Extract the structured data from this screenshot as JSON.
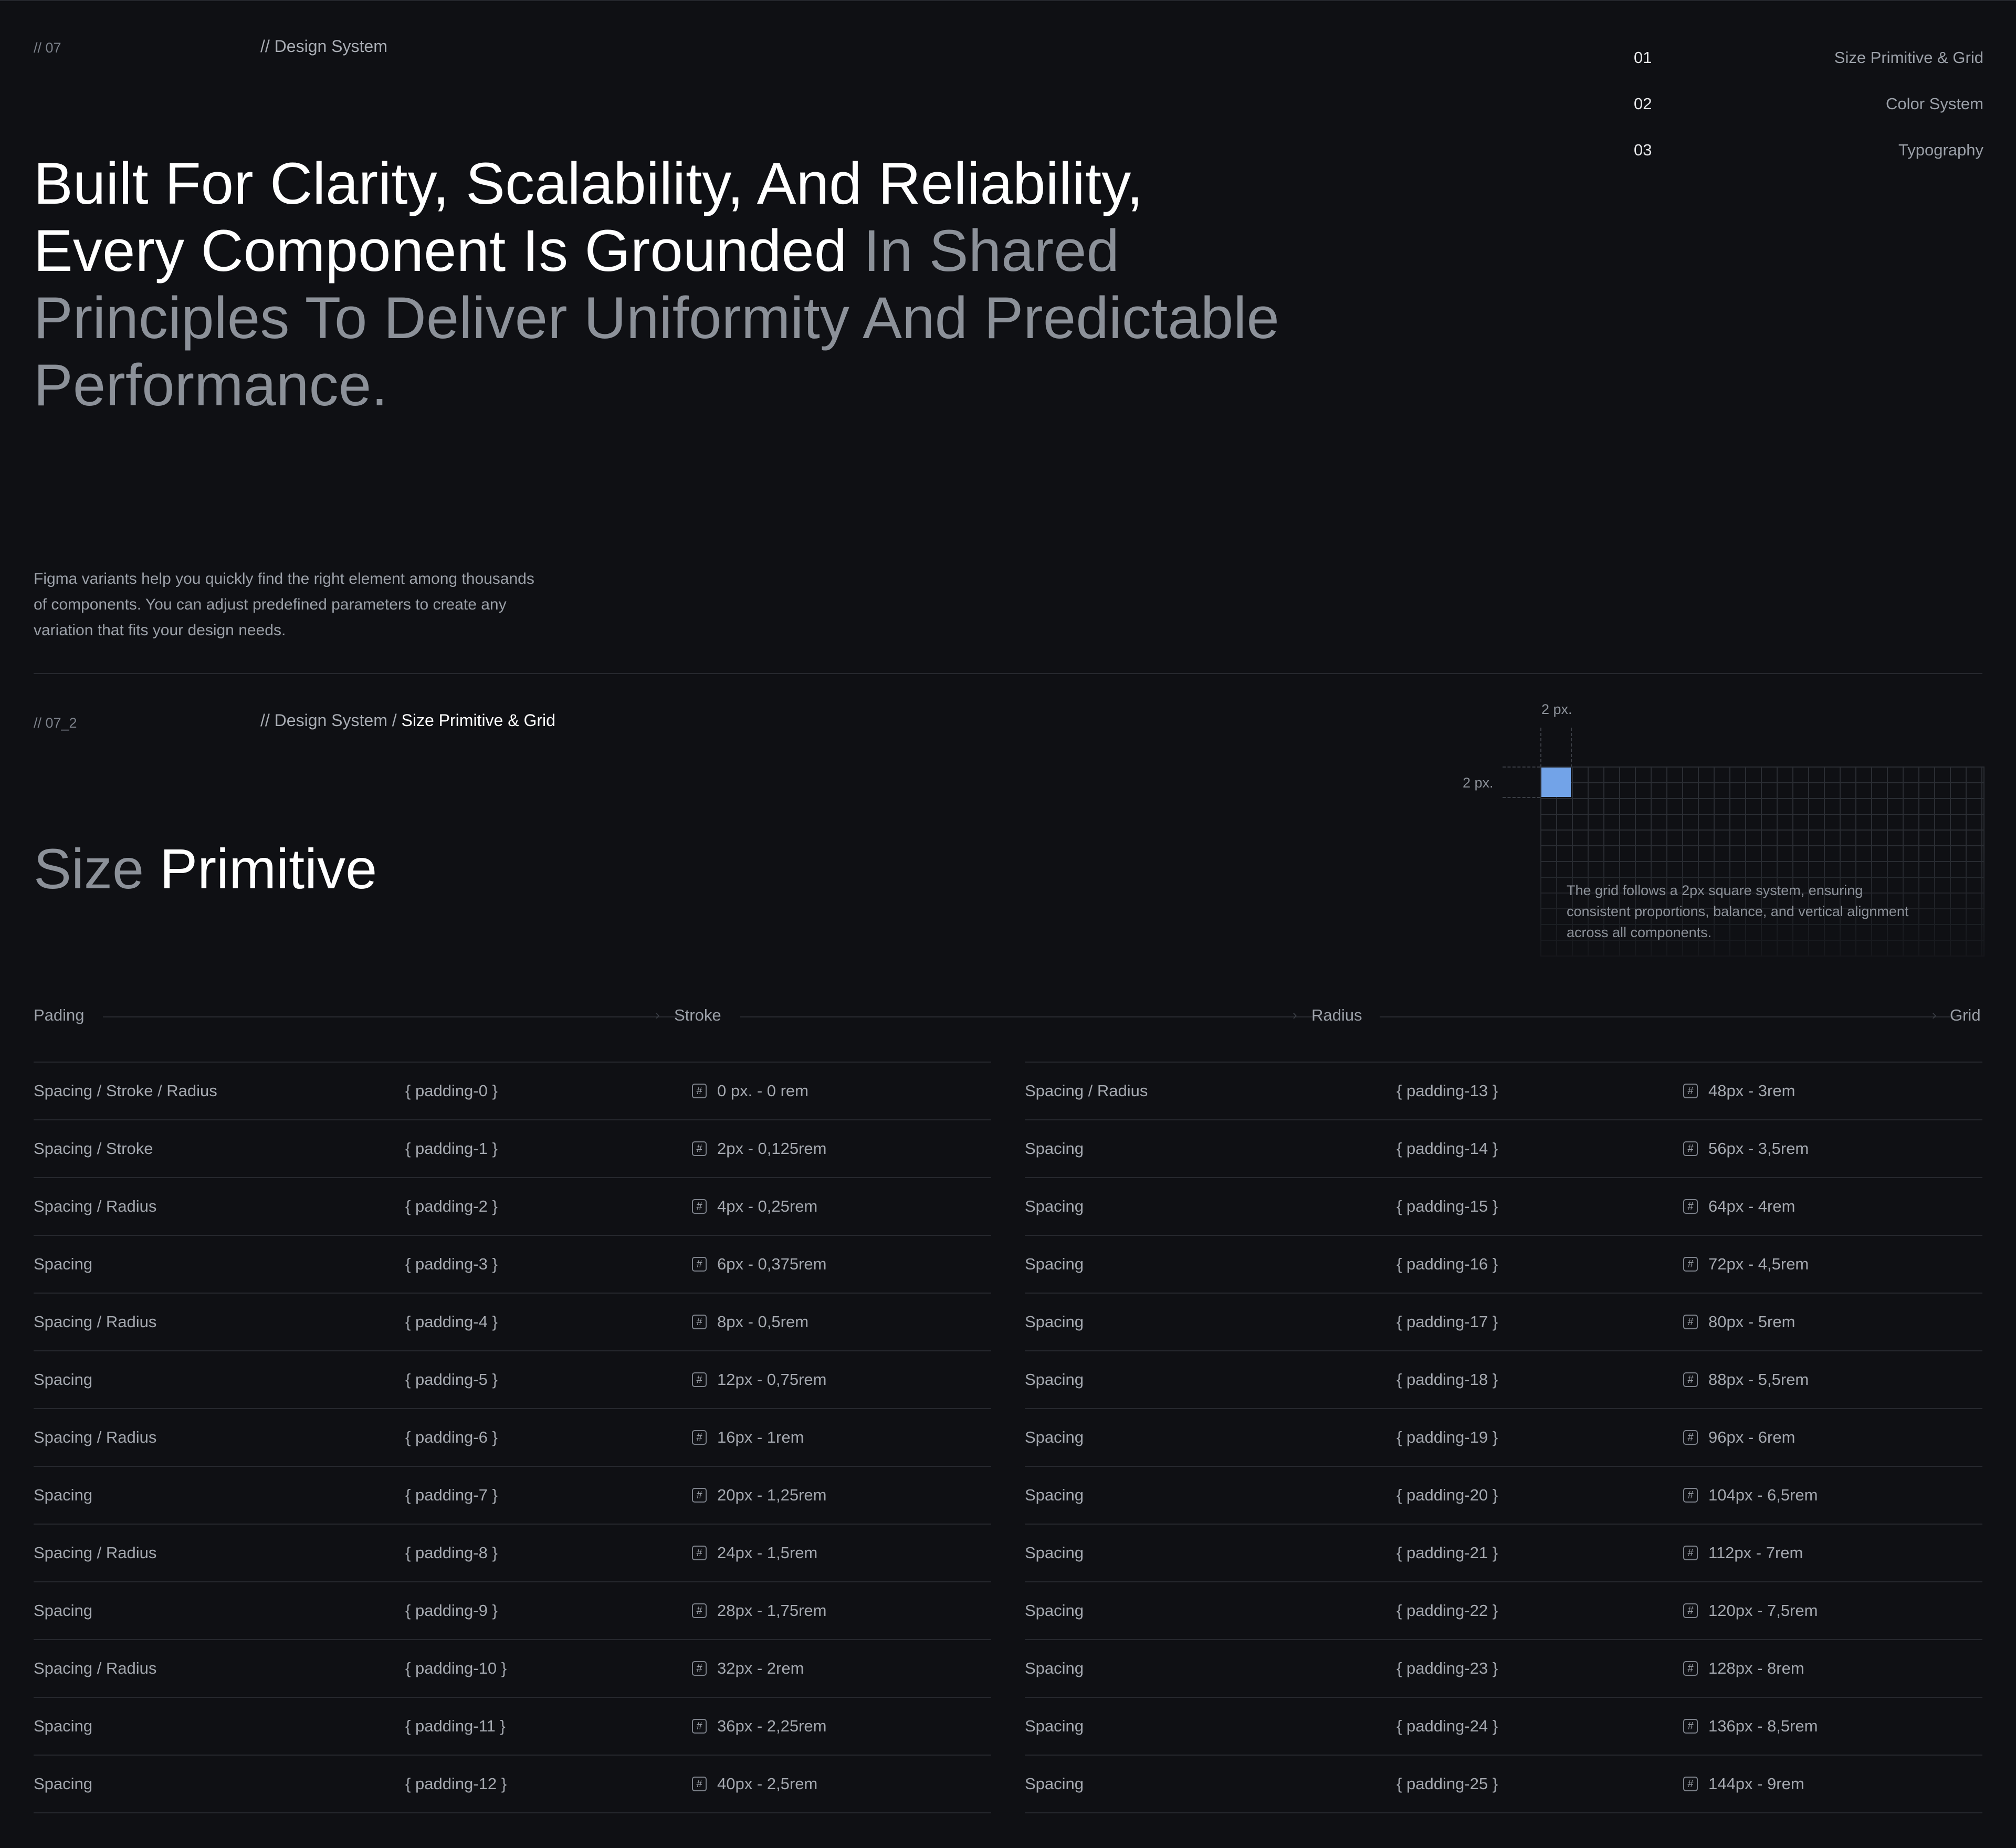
{
  "section_top": {
    "code": "// 07",
    "breadcrumb": "// Design System"
  },
  "toc": [
    {
      "num": "01",
      "label": "Size Primitive & Grid"
    },
    {
      "num": "02",
      "label": "Color System"
    },
    {
      "num": "03",
      "label": "Typography"
    }
  ],
  "hero": {
    "bright": "Built For Clarity, Scalability, And Reliability, Every Component Is Grounded",
    "muted": "In Shared Principles To Deliver Uniformity And Predictable Performance."
  },
  "intro": "Figma variants help you quickly find the right element among thousands of components. You can adjust predefined parameters to create any variation that fits your design needs.",
  "section_two": {
    "code": "// 07_2",
    "breadcrumb_prefix": "// Design System /",
    "breadcrumb_current": "Size Primitive & Grid",
    "title_muted": "Size",
    "title_bright": "Primitive"
  },
  "grid_demo": {
    "px_top": "2 px.",
    "px_left": "2 px.",
    "note": "The grid follows a 2px square system, ensuring consistent proportions, balance, and vertical alignment across all components.",
    "accent": "#72a3e8"
  },
  "flow": {
    "padding": "Pading",
    "stroke": "Stroke",
    "radius": "Radius",
    "grid": "Grid"
  },
  "table_left": [
    {
      "usage": "Spacing / Stroke / Radius",
      "token": "{ padding-0 }",
      "value": "0 px. - 0 rem"
    },
    {
      "usage": "Spacing / Stroke",
      "token": "{ padding-1 }",
      "value": "2px - 0,125rem"
    },
    {
      "usage": "Spacing / Radius",
      "token": "{ padding-2 }",
      "value": "4px - 0,25rem"
    },
    {
      "usage": "Spacing",
      "token": "{ padding-3 }",
      "value": "6px - 0,375rem"
    },
    {
      "usage": "Spacing / Radius",
      "token": "{ padding-4 }",
      "value": "8px - 0,5rem"
    },
    {
      "usage": "Spacing",
      "token": "{ padding-5 }",
      "value": "12px - 0,75rem"
    },
    {
      "usage": "Spacing / Radius",
      "token": "{ padding-6 }",
      "value": "16px - 1rem"
    },
    {
      "usage": "Spacing",
      "token": "{ padding-7 }",
      "value": "20px - 1,25rem"
    },
    {
      "usage": "Spacing / Radius",
      "token": "{ padding-8 }",
      "value": "24px - 1,5rem"
    },
    {
      "usage": "Spacing",
      "token": "{ padding-9 }",
      "value": "28px - 1,75rem"
    },
    {
      "usage": "Spacing / Radius",
      "token": "{ padding-10 }",
      "value": "32px - 2rem"
    },
    {
      "usage": "Spacing",
      "token": "{ padding-11 }",
      "value": "36px - 2,25rem"
    },
    {
      "usage": "Spacing",
      "token": "{ padding-12 }",
      "value": "40px - 2,5rem"
    }
  ],
  "table_right": [
    {
      "usage": "Spacing / Radius",
      "token": "{ padding-13 }",
      "value": "48px - 3rem"
    },
    {
      "usage": "Spacing",
      "token": "{ padding-14 }",
      "value": "56px - 3,5rem"
    },
    {
      "usage": "Spacing",
      "token": "{ padding-15 }",
      "value": "64px - 4rem"
    },
    {
      "usage": "Spacing",
      "token": "{ padding-16 }",
      "value": "72px - 4,5rem"
    },
    {
      "usage": "Spacing",
      "token": "{ padding-17 }",
      "value": "80px - 5rem"
    },
    {
      "usage": "Spacing",
      "token": "{ padding-18 }",
      "value": "88px - 5,5rem"
    },
    {
      "usage": "Spacing",
      "token": "{ padding-19 }",
      "value": "96px - 6rem"
    },
    {
      "usage": "Spacing",
      "token": "{ padding-20 }",
      "value": "104px - 6,5rem"
    },
    {
      "usage": "Spacing",
      "token": "{ padding-21 }",
      "value": "112px - 7rem"
    },
    {
      "usage": "Spacing",
      "token": "{ padding-22 }",
      "value": "120px - 7,5rem"
    },
    {
      "usage": "Spacing",
      "token": "{ padding-23 }",
      "value": "128px - 8rem"
    },
    {
      "usage": "Spacing",
      "token": "{ padding-24 }",
      "value": "136px - 8,5rem"
    },
    {
      "usage": "Spacing",
      "token": "{ padding-25 }",
      "value": "144px - 9rem"
    }
  ]
}
